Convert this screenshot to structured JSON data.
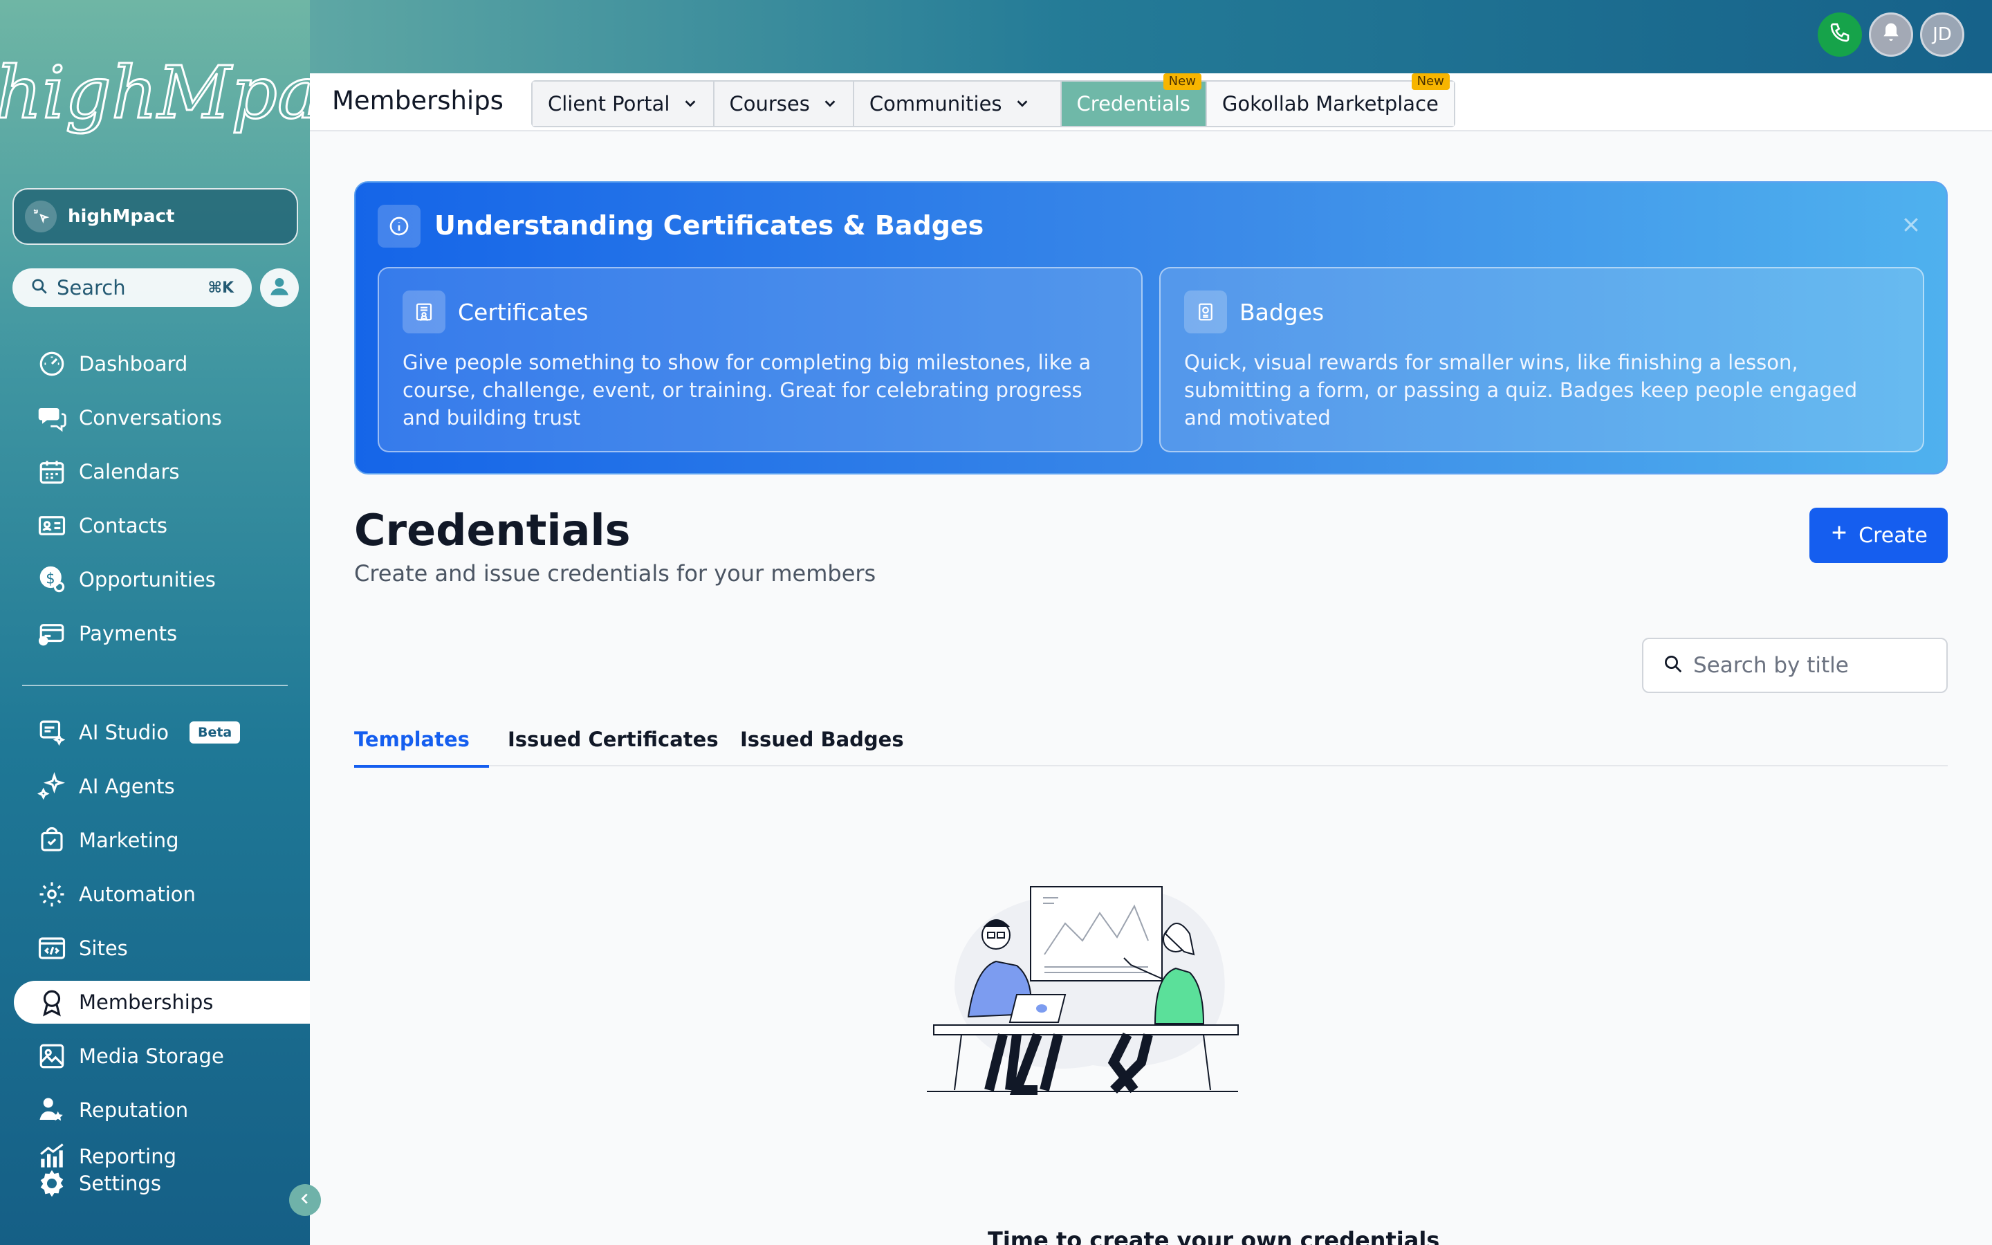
{
  "brand": {
    "logo_text": "highMpact"
  },
  "account": {
    "name": "highMpact"
  },
  "sidebar": {
    "search_label": "Search",
    "search_shortcut": "⌘K",
    "items": [
      {
        "label": "Dashboard",
        "icon": "dashboard-icon"
      },
      {
        "label": "Conversations",
        "icon": "conversations-icon"
      },
      {
        "label": "Calendars",
        "icon": "calendar-icon"
      },
      {
        "label": "Contacts",
        "icon": "contacts-icon"
      },
      {
        "label": "Opportunities",
        "icon": "opportunities-icon"
      },
      {
        "label": "Payments",
        "icon": "payments-icon"
      },
      {
        "label": "AI Studio",
        "icon": "ai-studio-icon",
        "badge": "Beta"
      },
      {
        "label": "AI Agents",
        "icon": "ai-agents-icon"
      },
      {
        "label": "Marketing",
        "icon": "marketing-icon"
      },
      {
        "label": "Automation",
        "icon": "automation-icon"
      },
      {
        "label": "Sites",
        "icon": "sites-icon"
      },
      {
        "label": "Memberships",
        "icon": "memberships-icon",
        "active": true
      },
      {
        "label": "Media Storage",
        "icon": "media-storage-icon"
      },
      {
        "label": "Reputation",
        "icon": "reputation-icon"
      },
      {
        "label": "Reporting",
        "icon": "reporting-icon"
      },
      {
        "label": "Settings",
        "icon": "settings-icon"
      }
    ]
  },
  "header": {
    "avatar_initials": "JD"
  },
  "subnav": {
    "title": "Memberships",
    "tabs": [
      {
        "label": "Client Portal",
        "has_dropdown": true
      },
      {
        "label": "Courses",
        "has_dropdown": true
      },
      {
        "label": "Communities",
        "has_dropdown": true
      },
      {
        "label": "Credentials",
        "active": true,
        "badge": "New"
      },
      {
        "label": "Gokollab Marketplace",
        "badge": "New"
      }
    ]
  },
  "banner": {
    "title": "Understanding Certificates & Badges",
    "cards": [
      {
        "title": "Certificates",
        "body": "Give people something to show for completing big milestones, like a course, challenge, event, or training. Great for celebrating progress and building trust"
      },
      {
        "title": "Badges",
        "body": "Quick, visual rewards for smaller wins, like finishing a lesson, submitting a form, or passing a quiz. Badges keep people engaged and motivated"
      }
    ]
  },
  "page": {
    "title": "Credentials",
    "subtitle": "Create and issue credentials for your members",
    "create_label": "Create",
    "search_placeholder": "Search by title",
    "tabs": [
      {
        "label": "Templates",
        "active": true
      },
      {
        "label": "Issued Certificates"
      },
      {
        "label": "Issued Badges"
      }
    ],
    "empty_state_partial": "Time to create your own credentials"
  },
  "colors": {
    "primary": "#155eef",
    "sidebar_top": "#6fb6a5",
    "sidebar_bottom": "#155f86",
    "active_tab": "#6fb8a8",
    "new_badge": "#f7b500",
    "phone": "#16a34a"
  }
}
